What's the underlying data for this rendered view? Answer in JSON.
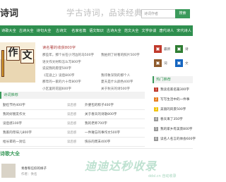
{
  "header": {
    "logo": "诗词",
    "slogan": "学古诗词，品读经典",
    "search_placeholder": "诗词作者",
    "search_button": "搜索"
  },
  "nav": [
    "诗歌大全",
    "古诗大全",
    "诗句大全",
    "古诗文",
    "名家名篇",
    "语文知识",
    "古诗大全",
    "范文大全",
    "文学杂谈",
    "唐代诗人",
    "宋代诗人"
  ],
  "banner": {
    "chars": [
      "作",
      "文"
    ]
  },
  "list": {
    "title": "读名著的收获800字",
    "lines": [
      "那些年，那个长在小河边的马500字",
      "语文作文材料怎么写800字",
      "说说我的愿望500字",
      "《在途上》读后800字",
      "那年的一家的六十年800字",
      "小区里的花园600字"
    ],
    "right_lines": [
      "我拍到了好看的照片500字",
      "",
      "",
      "我印象深刻的那个人",
      "夏天是什么颜色400字",
      "关于秋天的诗500字"
    ]
  },
  "sidebar": {
    "icons": [
      {
        "label": "最新",
        "color": "#c0392b"
      },
      {
        "label": "诗",
        "color": "#2e7d32"
      },
      {
        "label": "词",
        "color": "#8e5a2b"
      },
      {
        "label": "文",
        "color": "#1565c0"
      }
    ],
    "hot_title": "热门推荐",
    "hot": [
      "我读名家名篇300字",
      "写写生活中的一件事",
      "美丽的风景500字",
      "春天来了350字",
      "我的家乡有美景800字",
      "读名人名言的体会600字"
    ],
    "hot_colors": [
      "#c0392b",
      "#e67e22",
      "#f1c40f",
      "#999999",
      "#999999",
      "#999999"
    ]
  },
  "mid": {
    "head": "诗词推荐",
    "rows": [
      {
        "left": "勤俭节约400字",
        "tag": "读后感",
        "right": "外婆包的粽子400字"
      },
      {
        "left": "我的好朋友作文",
        "tag": "读后感",
        "right": "关于春天的诗歌800字"
      },
      {
        "left": "读后感100字",
        "tag": "读后感",
        "right": "我的老师700字"
      },
      {
        "left": "我家的年味儿800字",
        "tag": "读后感",
        "right": "一件难忘的事作文500字"
      },
      {
        "left": "给长辈的一封信",
        "tag": "读后感",
        "right": "快乐的周末400字"
      }
    ]
  },
  "bottom": {
    "title": "诗歌大全",
    "item_label": "青春和信仰的样子",
    "item_sub": "作者：佚名"
  },
  "watermark": "迪迪达秒收录",
  "watermark_small": "ddsl.cn 自动收录"
}
